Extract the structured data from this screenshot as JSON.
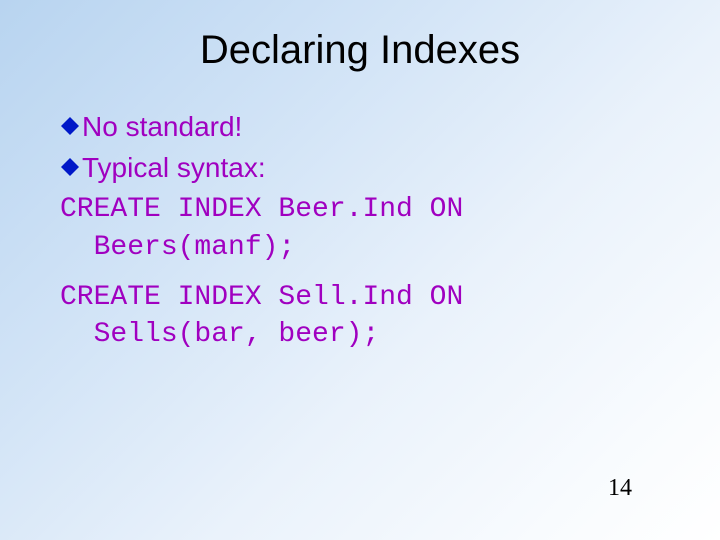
{
  "title": "Declaring Indexes",
  "bullets": [
    {
      "text": "No standard!"
    },
    {
      "text": "Typical syntax:"
    }
  ],
  "code": {
    "block1_line1": "CREATE INDEX Beer.Ind ON",
    "block1_line2": "  Beers(manf);",
    "block2_line1": "CREATE INDEX Sell.Ind ON",
    "block2_line2": "  Sells(bar, beer);"
  },
  "page_number": "14",
  "colors": {
    "bullet_text": "#a000c0",
    "bullet_marker": "#0018c8"
  }
}
